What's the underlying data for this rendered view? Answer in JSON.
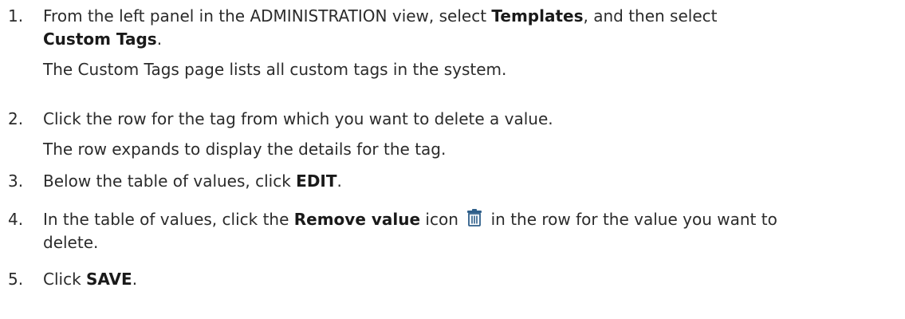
{
  "steps": [
    {
      "number": "1.",
      "parts": {
        "a": "From the left panel in the ADMINISTRATION view, select ",
        "b1": "Templates",
        "c": ", and then select",
        "b2": "Custom Tags",
        "d": "."
      },
      "note": "The Custom Tags page lists all custom tags in the system."
    },
    {
      "number": "2.",
      "text": "Click the row for the tag from which you want to delete a value.",
      "note": "The row expands to display the details for the tag."
    },
    {
      "number": "3.",
      "parts": {
        "a": "Below the table of values, click ",
        "b1": "EDIT",
        "c": "."
      }
    },
    {
      "number": "4.",
      "parts": {
        "a": "In the table of values, click the ",
        "b1": "Remove value",
        "c": " icon",
        "d": " in the row for the value you want to",
        "e": "delete."
      },
      "icon": "trash-icon"
    },
    {
      "number": "5.",
      "parts": {
        "a": "Click ",
        "b1": "SAVE",
        "c": "."
      }
    }
  ],
  "colors": {
    "text": "#2b2b2b",
    "icon": "#2f5f8a"
  }
}
